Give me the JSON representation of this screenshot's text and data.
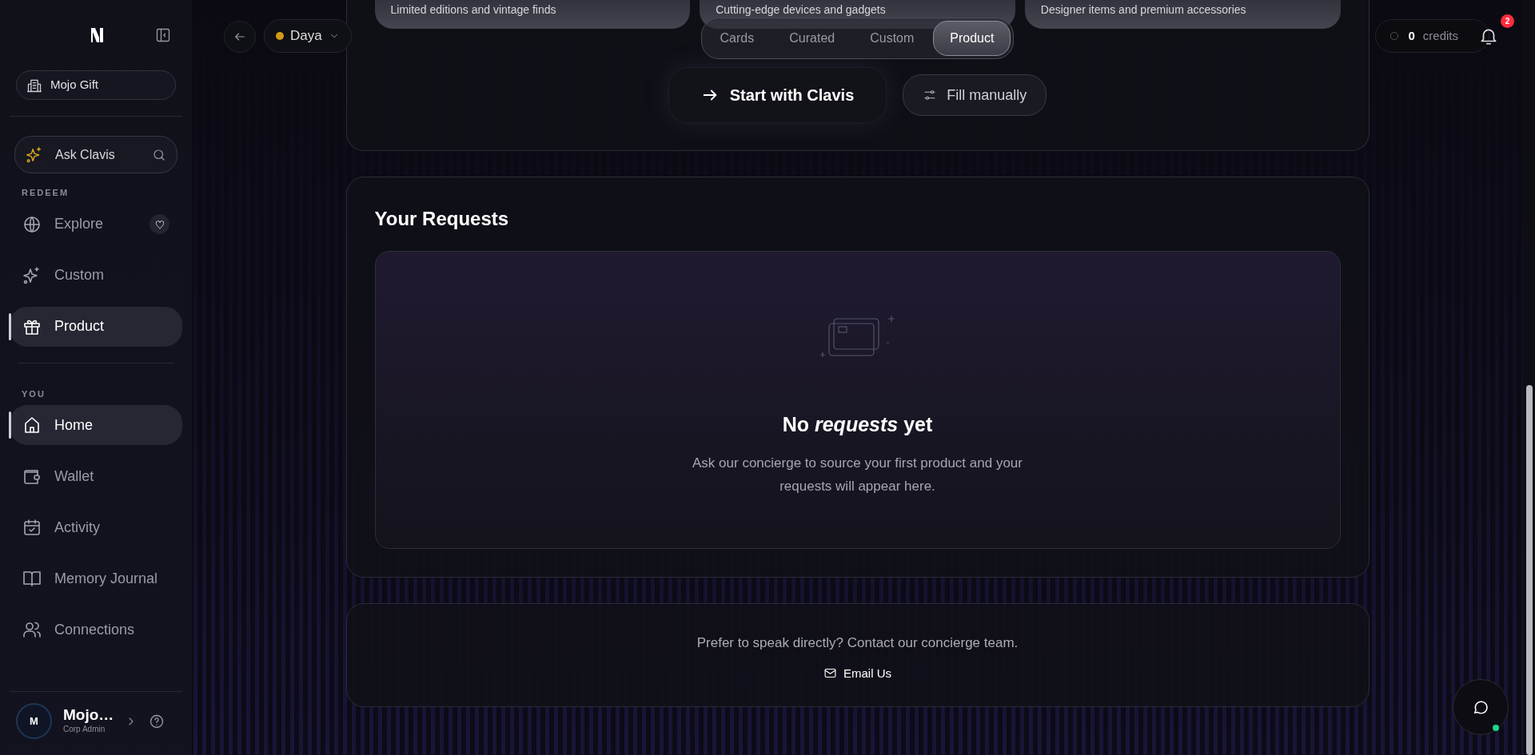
{
  "sidebar": {
    "workspace": "Mojo Gift",
    "search": {
      "placeholder": "Ask Clavis"
    },
    "sections": [
      {
        "label": "REDEEM",
        "items": [
          {
            "label": "Explore",
            "selected": false
          },
          {
            "label": "Custom",
            "selected": false
          },
          {
            "label": "Product",
            "selected": true
          }
        ]
      },
      {
        "label": "YOU",
        "items": [
          {
            "label": "Home",
            "selected": true
          },
          {
            "label": "Wallet",
            "selected": false
          },
          {
            "label": "Activity",
            "selected": false
          },
          {
            "label": "Memory Journal",
            "selected": false
          },
          {
            "label": "Connections",
            "selected": false
          }
        ]
      }
    ],
    "user": {
      "initial": "M",
      "name": "Mojo…",
      "role": "Corp Admin"
    }
  },
  "header": {
    "account": "Daya",
    "credits_value": "0",
    "credits_label": "credits",
    "notifications": "2"
  },
  "categories": [
    {
      "subtitle": "Limited editions and vintage finds"
    },
    {
      "subtitle": "Cutting-edge devices and gadgets"
    },
    {
      "subtitle": "Designer items and premium accessories"
    }
  ],
  "tabs": [
    {
      "label": "Cards",
      "selected": false
    },
    {
      "label": "Curated",
      "selected": false
    },
    {
      "label": "Custom",
      "selected": false
    },
    {
      "label": "Product",
      "selected": true
    }
  ],
  "actions": [
    {
      "label": "Start with Clavis",
      "kind": "primary"
    },
    {
      "label": "Fill manually",
      "kind": "secondary"
    }
  ],
  "requests": {
    "title": "Your Requests",
    "empty_title": "No *requests* yet",
    "empty_text": "Ask our concierge to source your first product and your requests will appear here."
  },
  "contact": {
    "text": "Prefer to speak directly? Contact our concierge team.",
    "link": "Email Us"
  }
}
